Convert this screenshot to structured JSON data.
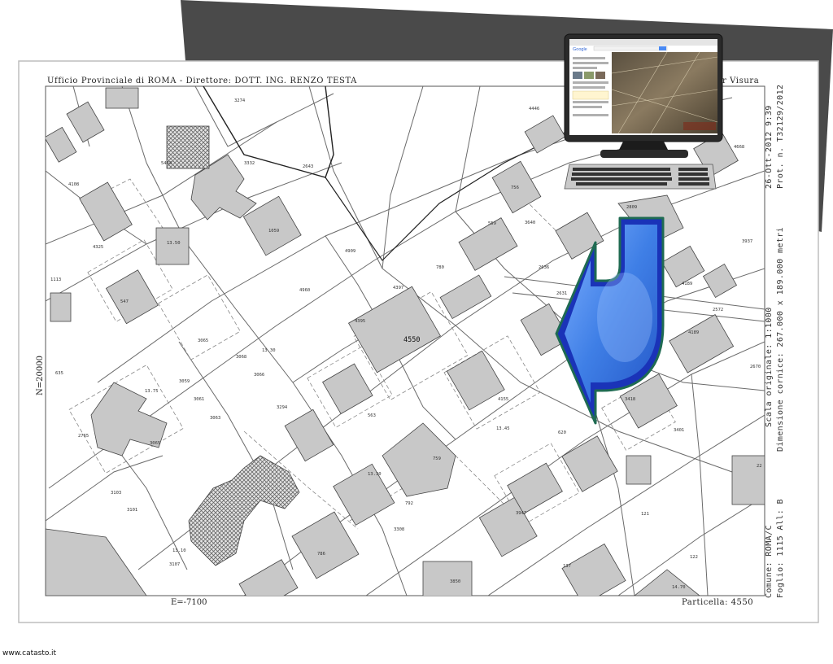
{
  "header": {
    "office": "Ufficio Provinciale di ROMA - Direttore: DOTT. ING. RENZO TESTA",
    "visura_fragment": "r Visura"
  },
  "right_margin": {
    "date": "26-Ott-2012  9:39",
    "protocol": "Prot. n. T32129/2012",
    "scale": "Scala originale: 1:1000",
    "dimension": "Dimensione cornice: 267.000 x 189.000 metri",
    "comune": "Comune: ROMA/C",
    "foglio": "Foglio: 1115 All: B"
  },
  "coordinates": {
    "north": "N=20000",
    "east": "E=-7100"
  },
  "bottom": {
    "particella": "Particella: 4550"
  },
  "watermark": "www.catasto.it",
  "parcels": {
    "main": "4550",
    "labels": [
      "3274",
      "5464",
      "3332",
      "2643",
      "4108",
      "4325",
      "13.50",
      "1059",
      "1113",
      "547",
      "4325",
      "3065",
      "3068",
      "3066",
      "4960",
      "4909",
      "780",
      "4397",
      "4395",
      "559",
      "3640",
      "756",
      "4446",
      "4668",
      "2809",
      "2636",
      "2631",
      "4189",
      "3937",
      "2572",
      "4189",
      "2670",
      "3059",
      "3061",
      "3063",
      "13.75",
      "3065",
      "635",
      "563",
      "13.30",
      "4155",
      "620",
      "3418",
      "3294",
      "13.45",
      "759",
      "792",
      "3947",
      "121",
      "3308",
      "13.30",
      "3103",
      "3101",
      "2765",
      "3107",
      "13.10",
      "786",
      "3850",
      "137",
      "122",
      "14.70",
      "3401",
      "22"
    ]
  },
  "computer": {
    "search_brand": "Google"
  },
  "colors": {
    "sheet_shadow": "#4a4a4a",
    "building_fill": "#c8c8c8",
    "arrow_fill": "#3f7fe6",
    "arrow_edge": "#1a33b8",
    "arrow_outline": "#1f6b52"
  },
  "icons": [
    "computer-monitor-icon",
    "keyboard-icon",
    "curved-arrow-icon"
  ]
}
